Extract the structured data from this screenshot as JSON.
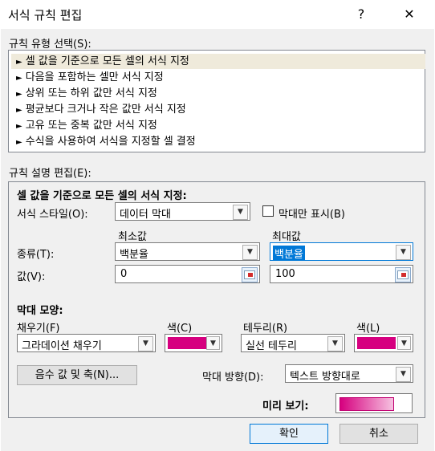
{
  "window": {
    "title": "서식 규칙 편집",
    "help_glyph": "?",
    "close_glyph": "✕"
  },
  "rule_type": {
    "label": "규칙 유형 선택(S):",
    "items": [
      "셀 값을 기준으로 모든 셀의 서식 지정",
      "다음을 포함하는 셀만 서식 지정",
      "상위 또는 하위 값만 서식 지정",
      "평균보다 크거나 작은 값만 서식 지정",
      "고유 또는 중복 값만 서식 지정",
      "수식을 사용하여 서식을 지정할 셀 결정"
    ],
    "selected_index": 0
  },
  "rule_desc": {
    "label": "규칙 설명 편집(E):",
    "heading": "셀 값을 기준으로 모든 셀의 서식 지정:",
    "format_style_label": "서식 스타일(O):",
    "format_style_value": "데이터 막대",
    "bar_only_label": "막대만 표시(B)",
    "bar_only_checked": false,
    "min_header": "최소값",
    "max_header": "최대값",
    "type_label": "종류(T):",
    "min_type": "백분율",
    "max_type": "백분율",
    "value_label": "값(V):",
    "min_value": "0",
    "max_value": "100"
  },
  "bar_appearance": {
    "heading": "막대 모양:",
    "fill_label": "채우기(F)",
    "fill_value": "그라데이션 채우기",
    "fill_color_label": "색(C)",
    "border_label": "테두리(R)",
    "border_value": "실선 테두리",
    "border_color_label": "색(L)",
    "bar_color": "#d6007f",
    "negative_button": "음수 값 및 축(N)...",
    "direction_label": "막대 방향(D):",
    "direction_value": "텍스트 방향대로",
    "preview_label": "미리 보기:"
  },
  "footer": {
    "ok": "확인",
    "cancel": "취소"
  }
}
